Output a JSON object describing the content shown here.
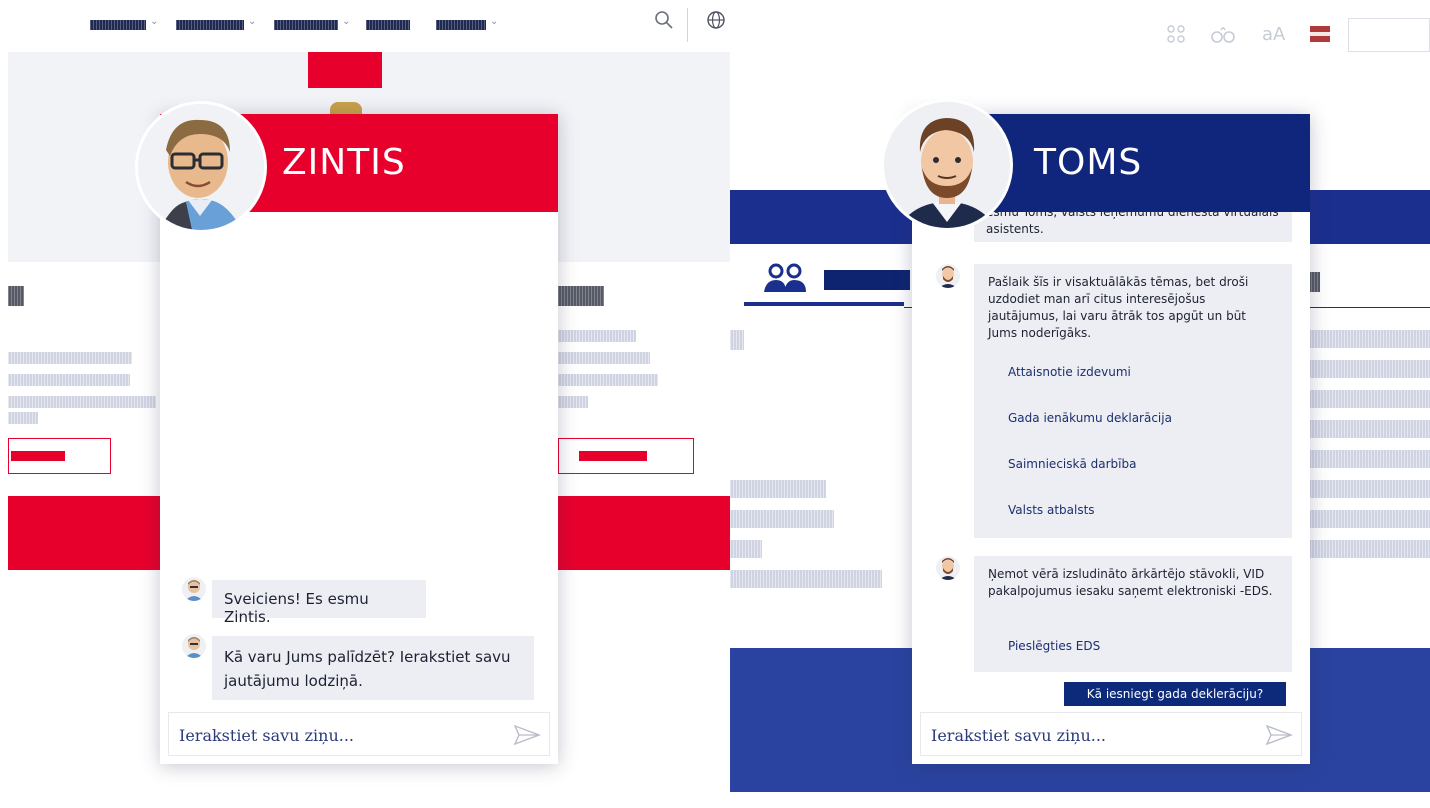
{
  "colors": {
    "zintis_red": "#e8002d",
    "toms_blue": "#10257c",
    "site_blue": "#1b2f8f",
    "stripe_gray": "#cfd3e2"
  },
  "left": {
    "nav_icons": [
      "search-icon",
      "globe-icon"
    ],
    "chat": {
      "name": "ZINTIS",
      "messages": [
        "Sveiciens! Es esmu Zintis.",
        "Kā varu Jums palīdzēt? Ierakstiet savu jautājumu lodziņā."
      ],
      "input_placeholder": "Ierakstiet savu ziņu..."
    }
  },
  "right": {
    "toolbar_icons": [
      "link-icon",
      "glasses-icon",
      "font-size-icon",
      "flag-icon"
    ],
    "toolbar": {
      "font_size_label": "aA"
    },
    "chat": {
      "name": "TOMS",
      "message_partial": "esmu Toms, valsts ieņēmumu dienesta virtuālais asistents.",
      "message_topics": "Pašlaik šīs ir visaktuālākās tēmas, bet droši uzdodiet man arī citus interesējošus jautājumus, lai varu ātrāk tos apgūt un būt Jums noderīgāks.",
      "topics": [
        "Attaisnotie izdevumi",
        "Gada ienākumu deklarācija",
        "Saimnieciskā darbība",
        "Valsts atbalsts"
      ],
      "message_eds": "Ņemot vērā izsludināto ārkārtējo stāvokli, VID pakalpojumus iesaku saņemt elektroniski -EDS.",
      "eds_link": "Pieslēgties EDS",
      "quick_reply": "Kā iesniegt gada deklerāciju?",
      "input_placeholder": "Ierakstiet savu ziņu..."
    }
  }
}
